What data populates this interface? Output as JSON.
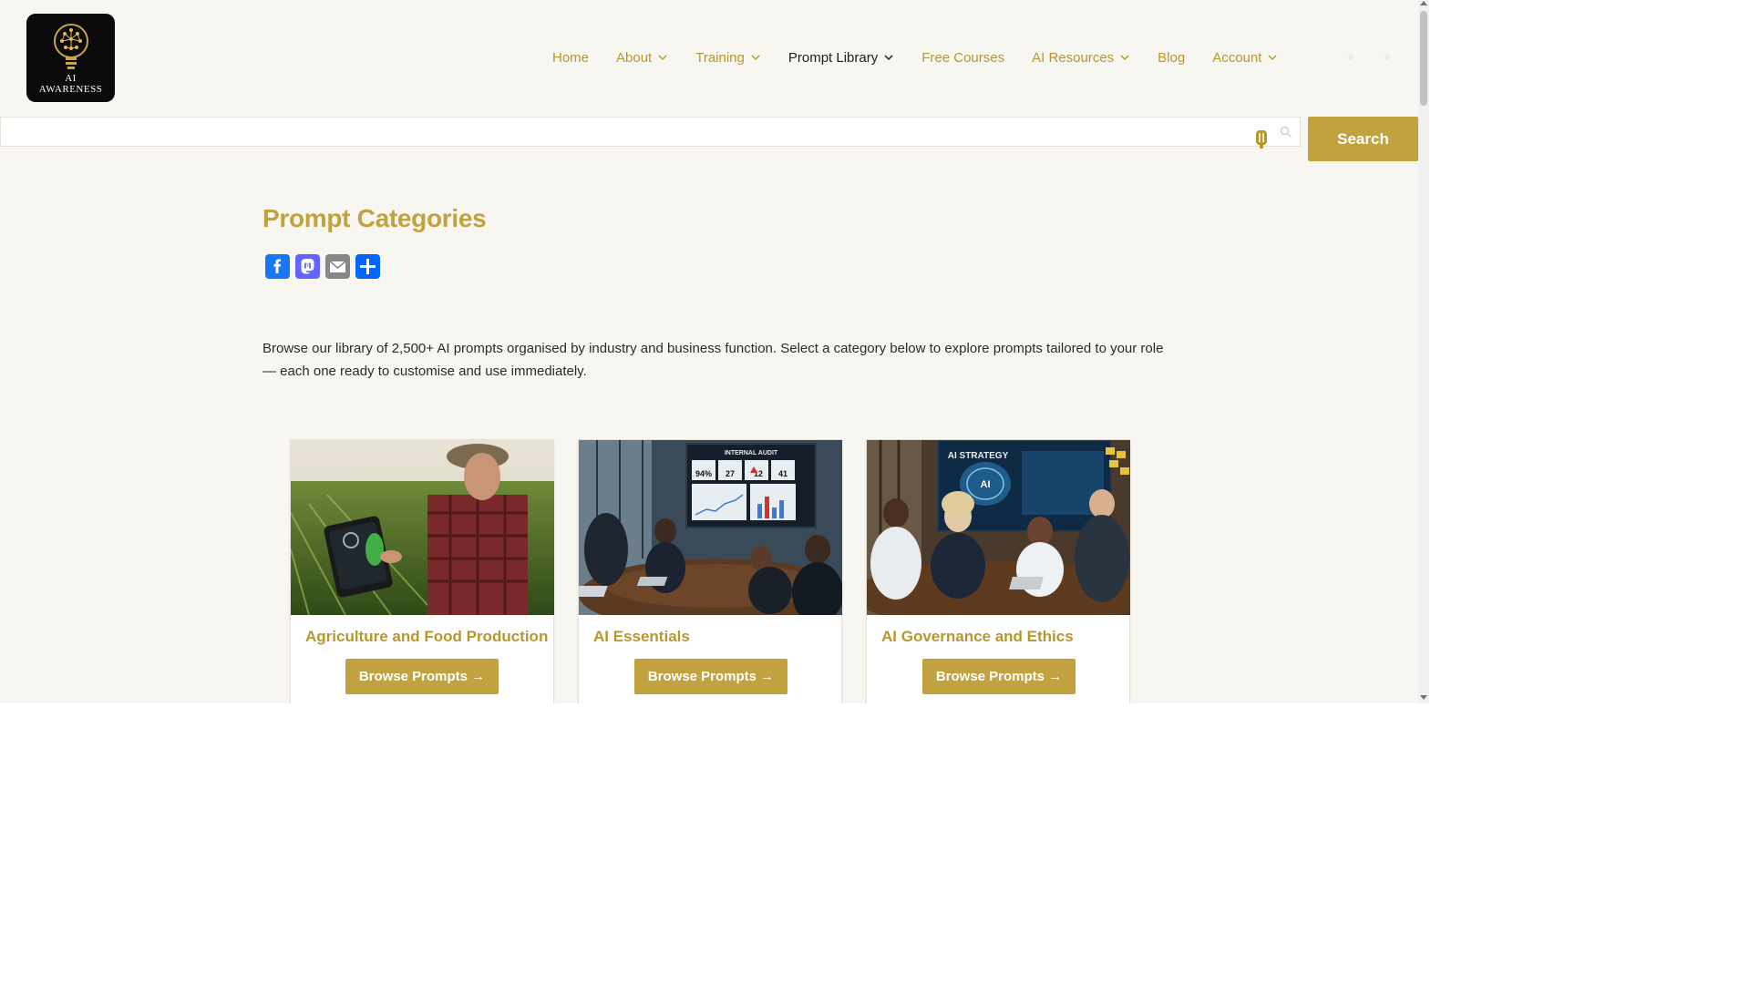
{
  "logo": {
    "text_line1": "AI",
    "text_line2": "AWARENESS"
  },
  "nav": {
    "items": [
      {
        "label": "Home",
        "has_dropdown": false,
        "active": false
      },
      {
        "label": "About",
        "has_dropdown": true,
        "active": false
      },
      {
        "label": "Training",
        "has_dropdown": true,
        "active": false
      },
      {
        "label": "Prompt Library",
        "has_dropdown": true,
        "active": true
      },
      {
        "label": "Free Courses",
        "has_dropdown": false,
        "active": false
      },
      {
        "label": "AI Resources",
        "has_dropdown": true,
        "active": false
      },
      {
        "label": "Blog",
        "has_dropdown": false,
        "active": false
      },
      {
        "label": "Account",
        "has_dropdown": true,
        "active": false
      }
    ]
  },
  "search": {
    "value": "",
    "placeholder": "",
    "button_label": "Search"
  },
  "main": {
    "title": "Prompt Categories",
    "share_icons": [
      "facebook-icon",
      "mastodon-icon",
      "email-icon",
      "share-plus-icon"
    ],
    "intro": "Browse our library of 2,500+ AI prompts organised by industry and business function. Select a category below to explore prompts tailored to your role — each one ready to customise and use immediately.",
    "cards": [
      {
        "title": "Agriculture and Food Production",
        "button_label": "Browse Prompts →"
      },
      {
        "title": "AI Essentials",
        "button_label": "Browse Prompts →"
      },
      {
        "title": "AI Governance and Ethics",
        "button_label": "Browse Prompts →"
      }
    ],
    "card_images": {
      "audit_board_title": "INTERNAL AUDIT",
      "audit_stats": [
        "94%",
        "27",
        "12",
        "41"
      ],
      "strategy_board_title": "AI STRATEGY",
      "strategy_center": "AI"
    }
  },
  "colors": {
    "accent": "#c2a23f",
    "nav_link": "#b8962e",
    "background": "#f8f6f1",
    "facebook": "#1877f2",
    "mastodon": "#6364ff",
    "email": "#888888",
    "share": "#0166ff"
  }
}
